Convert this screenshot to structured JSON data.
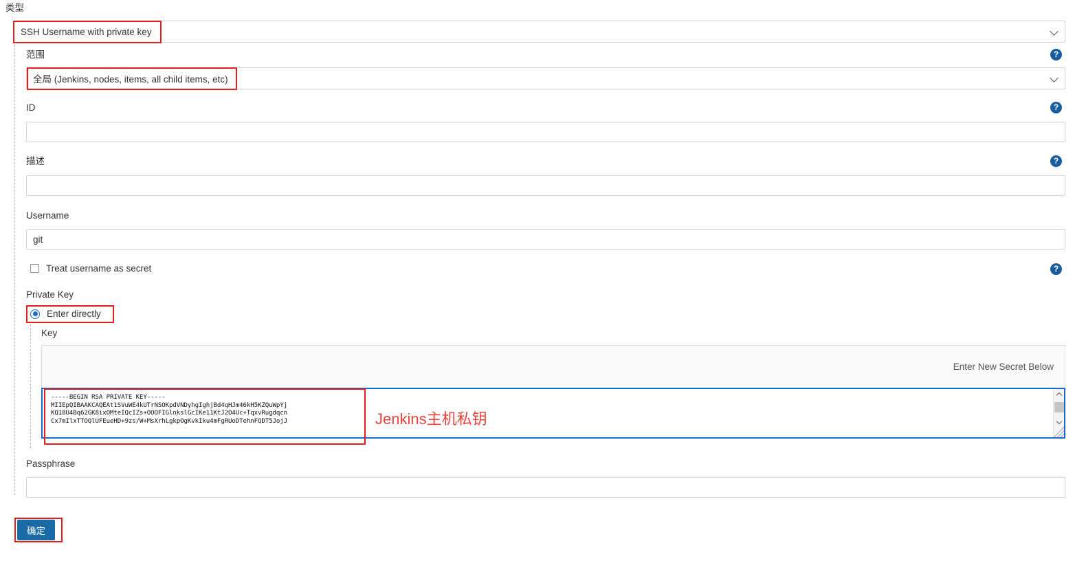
{
  "form": {
    "type_section": {
      "label": "类型",
      "selected": "SSH Username with private key"
    },
    "scope_section": {
      "label": "范围",
      "selected_primary": "全局",
      "selected_secondary": " (Jenkins, nodes, items, all child items, etc)",
      "help": "?"
    },
    "id_section": {
      "label": "ID",
      "value": "",
      "help": "?"
    },
    "description_section": {
      "label": "描述",
      "value": "",
      "help": "?"
    },
    "username_section": {
      "label": "Username",
      "value": "git"
    },
    "treat_secret": {
      "label": "Treat username as secret",
      "checked": false,
      "help": "?"
    },
    "private_key_section": {
      "label": "Private Key",
      "radio_label": "Enter directly",
      "radio_selected": true,
      "key_label": "Key",
      "secret_hint": "Enter New Secret Below",
      "key_value": "-----BEGIN RSA PRIVATE KEY-----\nMIIEpQIBAAKCAQEAt1SVuWE4kUTrNSOKpdVNDyhgIghjBd4qHJm46kH5KZQuWpYj\nKQ18U4Bq62GK8ixOMteIQcIZs+OOOFIGlnkslGcIKe11KtJ2O4Uc+TqxvRugdqcn\nCx7mIlxTTOQlUFEueHD+9zs/W+MsXrhLgkpOgKvkIku4mFgRUoDTehnFQDT5JojJ"
    },
    "passphrase_section": {
      "label": "Passphrase",
      "value": ""
    },
    "submit": {
      "label": "确定"
    }
  },
  "annotations": {
    "private_key_note": "Jenkins主机私钥",
    "accent_red": "#e02020",
    "note_red": "#e8443c",
    "jenkins_blue": "#1a6aa5"
  }
}
